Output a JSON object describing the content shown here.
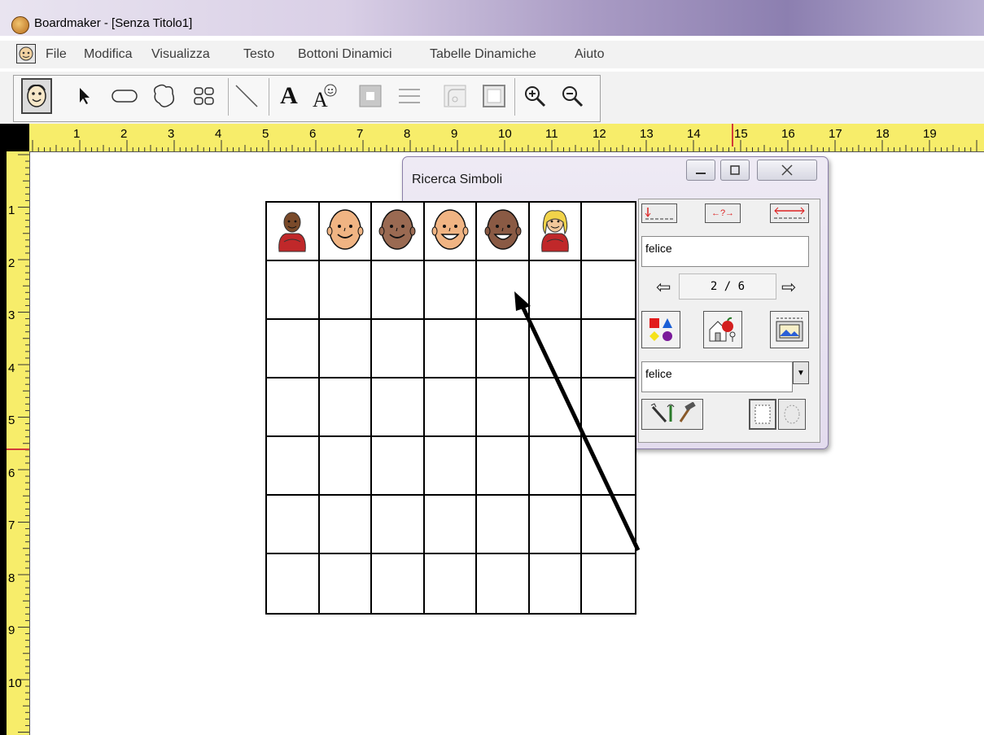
{
  "window": {
    "title": "Boardmaker - [Senza Titolo1]"
  },
  "menu": {
    "items": [
      "File",
      "Modifica",
      "Visualizza",
      "Testo",
      "Bottoni Dinamici",
      "Tabelle Dinamiche",
      "Aiuto"
    ]
  },
  "toolbar": {
    "tools": [
      "symbol-finder-icon",
      "pointer-icon",
      "rounded-rect-icon",
      "freeform-icon",
      "grid-icon",
      "line-icon",
      "text-icon",
      "symbol-text-icon",
      "fill-color-icon",
      "line-thickness-icon",
      "corner-style-icon",
      "frame-icon",
      "zoom-in-icon",
      "zoom-out-icon"
    ],
    "text_tool_glyph": "A"
  },
  "ruler": {
    "top_labels": [
      "1",
      "2",
      "3",
      "4",
      "5",
      "6",
      "7",
      "8",
      "9",
      "10",
      "11",
      "12",
      "13",
      "14",
      "15",
      "16",
      "17",
      "18",
      "19"
    ],
    "left_labels": [
      "1",
      "2",
      "3",
      "4",
      "5",
      "6",
      "7",
      "8",
      "9",
      "10"
    ]
  },
  "symbol_finder": {
    "title": "Ricerca Simboli",
    "search_text": "felice",
    "page_indicator": "2 / 6",
    "label_text": "felice",
    "top_button_glyph": "←?→"
  },
  "board": {
    "rows": 7,
    "cols": 7,
    "symbols": [
      {
        "skin": "#7a4a2a",
        "shirt": "#c0282a",
        "type": "child"
      },
      {
        "skin": "#f0b483",
        "shirt": null,
        "type": "face"
      },
      {
        "skin": "#9a6a52",
        "shirt": null,
        "type": "face"
      },
      {
        "skin": "#f0b483",
        "shirt": null,
        "type": "face-open"
      },
      {
        "skin": "#8a5a44",
        "shirt": null,
        "type": "face-open"
      },
      {
        "skin": "#f2c79a",
        "shirt": "#c0282a",
        "type": "child-blond"
      },
      null
    ]
  },
  "colors": {
    "ruler": "#f7ed6a",
    "accent": "#c0282a",
    "dialog": "#e6e0f0"
  }
}
